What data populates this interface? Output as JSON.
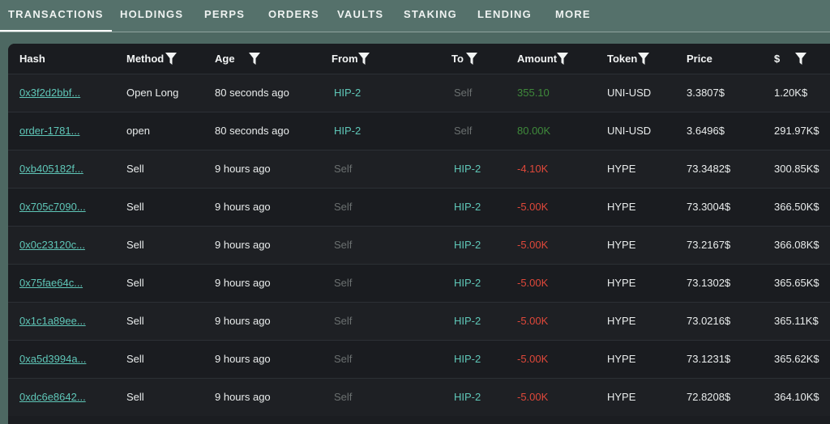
{
  "tabs": [
    {
      "label": "TRANSACTIONS",
      "active": true
    },
    {
      "label": "HOLDINGS",
      "active": false
    },
    {
      "label": "PERPS",
      "active": false
    },
    {
      "label": "ORDERS",
      "active": false
    },
    {
      "label": "VAULTS",
      "active": false
    },
    {
      "label": "STAKING",
      "active": false
    },
    {
      "label": "LENDING",
      "active": false
    },
    {
      "label": "MORE",
      "active": false
    }
  ],
  "table": {
    "columns": [
      {
        "label": "Hash",
        "filter": false
      },
      {
        "label": "Method",
        "filter": true
      },
      {
        "label": "Age",
        "filter": true
      },
      {
        "label": "From",
        "filter": true
      },
      {
        "label": "To",
        "filter": true
      },
      {
        "label": "Amount",
        "filter": true
      },
      {
        "label": "Token",
        "filter": true
      },
      {
        "label": "Price",
        "filter": false
      },
      {
        "label": "$",
        "filter": true
      }
    ],
    "rows": [
      {
        "hash": "0x3f2d2bbf...",
        "method": "Open Long",
        "age": "80 seconds ago",
        "from": "HIP-2",
        "to": "Self",
        "amount": "355.10",
        "token": "UNI-USD",
        "price": "3.3807$",
        "usd": "1.20K$"
      },
      {
        "hash": "order-1781...",
        "method": "open",
        "age": "80 seconds ago",
        "from": "HIP-2",
        "to": "Self",
        "amount": "80.00K",
        "token": "UNI-USD",
        "price": "3.6496$",
        "usd": "291.97K$"
      },
      {
        "hash": "0xb405182f...",
        "method": "Sell",
        "age": "9 hours ago",
        "from": "Self",
        "to": "HIP-2",
        "amount": "-4.10K",
        "token": "HYPE",
        "price": "73.3482$",
        "usd": "300.85K$"
      },
      {
        "hash": "0x705c7090...",
        "method": "Sell",
        "age": "9 hours ago",
        "from": "Self",
        "to": "HIP-2",
        "amount": "-5.00K",
        "token": "HYPE",
        "price": "73.3004$",
        "usd": "366.50K$"
      },
      {
        "hash": "0x0c23120c...",
        "method": "Sell",
        "age": "9 hours ago",
        "from": "Self",
        "to": "HIP-2",
        "amount": "-5.00K",
        "token": "HYPE",
        "price": "73.2167$",
        "usd": "366.08K$"
      },
      {
        "hash": "0x75fae64c...",
        "method": "Sell",
        "age": "9 hours ago",
        "from": "Self",
        "to": "HIP-2",
        "amount": "-5.00K",
        "token": "HYPE",
        "price": "73.1302$",
        "usd": "365.65K$"
      },
      {
        "hash": "0x1c1a89ee...",
        "method": "Sell",
        "age": "9 hours ago",
        "from": "Self",
        "to": "HIP-2",
        "amount": "-5.00K",
        "token": "HYPE",
        "price": "73.0216$",
        "usd": "365.11K$"
      },
      {
        "hash": "0xa5d3994a...",
        "method": "Sell",
        "age": "9 hours ago",
        "from": "Self",
        "to": "HIP-2",
        "amount": "-5.00K",
        "token": "HYPE",
        "price": "73.1231$",
        "usd": "365.62K$"
      },
      {
        "hash": "0xdc6e8642...",
        "method": "Sell",
        "age": "9 hours ago",
        "from": "Self",
        "to": "HIP-2",
        "amount": "-5.00K",
        "token": "HYPE",
        "price": "72.8208$",
        "usd": "364.10K$"
      }
    ]
  },
  "icons": {
    "filter": "filter-funnel-icon"
  },
  "colors": {
    "accent": "#5fc7b8",
    "positive": "#3f8a3b",
    "negative": "#e0483a",
    "muted": "#6b7070"
  }
}
